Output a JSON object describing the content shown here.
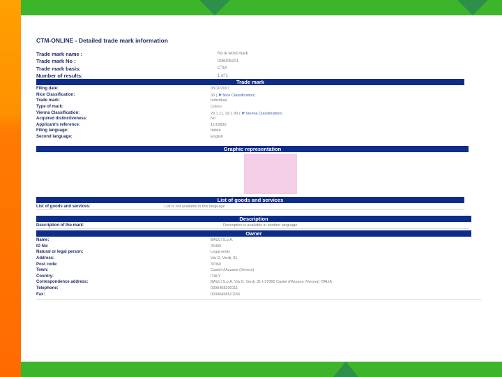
{
  "page_title": "CTM-ONLINE - Detailed trade mark information",
  "summary": [
    {
      "label": "Trade mark name :",
      "value": "No ie word mark"
    },
    {
      "label": "Trade mark No :",
      "value": "006005201"
    },
    {
      "label": "Trade mark basis:",
      "value": "CTM"
    },
    {
      "label": "Number of results:",
      "value": "1 of 1"
    }
  ],
  "sections": {
    "trade_mark": "Trade mark",
    "graphic": "Graphic representation",
    "goods": "List of goods and services",
    "description": "Description",
    "owner": "Owner"
  },
  "trade_mark_rows": [
    {
      "label": "Filing date:",
      "value": "05/11/2007"
    },
    {
      "label": "Nice Classification:",
      "value": "30 (",
      "link": "Nice Classification",
      "suffix": ")"
    },
    {
      "label": "Trade mark:",
      "value": "Individual"
    },
    {
      "label": "Type of mark:",
      "value": "Colour"
    },
    {
      "label": "Vienna Classification:",
      "value": "29.1.11, 29.1.99 (",
      "link": "Vienna Classification",
      "suffix": ")"
    },
    {
      "label": "Acquired distinctiveness:",
      "value": "No"
    },
    {
      "label": "Applicant's reference:",
      "value": "11/19930"
    },
    {
      "label": "Filing language:",
      "value": "Italian"
    },
    {
      "label": "Second language:",
      "value": "English"
    }
  ],
  "goods": {
    "label": "List of goods and services:",
    "value": "List is not available in this language"
  },
  "description": {
    "label": "Description of the mark:",
    "value": "Description is available in another language"
  },
  "owner_rows": [
    {
      "label": "Name:",
      "value": "BAULI S.p.A."
    },
    {
      "label": "ID No:",
      "value": "25405"
    },
    {
      "label": "Natural or legal person:",
      "value": "Legal entity"
    },
    {
      "label": "Address:",
      "value": "Via G. Verdi, 31"
    },
    {
      "label": "Post code:",
      "value": "37060"
    },
    {
      "label": "Town:",
      "value": "Castel d'Azzano (Verona)"
    },
    {
      "label": "Country:",
      "value": "ITALY"
    },
    {
      "label": "Correspondence address:",
      "value": "BAULI S.p.A. Via G. Verdi, 31 I-37060 Castel d'Azzano (Verona) ITALIA"
    },
    {
      "label": "Telephone:",
      "value": "0390458200111"
    },
    {
      "label": "Fax:",
      "value": "00390458521156"
    }
  ],
  "colors": {
    "header": "#0e2d8a",
    "green": "#3db52a",
    "orange": "#ff8a00",
    "graphic_swatch": "#f4cde6"
  }
}
